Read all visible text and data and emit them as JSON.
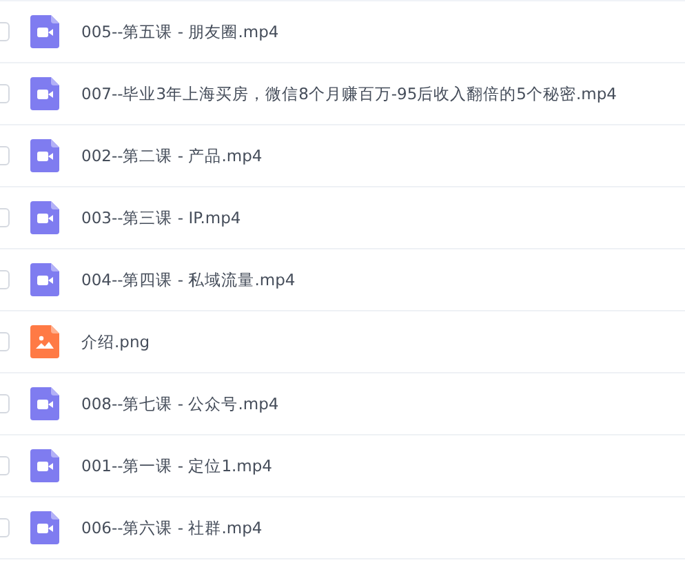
{
  "files": [
    {
      "name": "005--第五课 - 朋友圈.mp4",
      "kind": "video",
      "checked": false
    },
    {
      "name": "007--毕业3年上海买房，微信8个月赚百万-95后收入翻倍的5个秘密.mp4",
      "kind": "video",
      "checked": false
    },
    {
      "name": "002--第二课 - 产品.mp4",
      "kind": "video",
      "checked": false
    },
    {
      "name": "003--第三课 - IP.mp4",
      "kind": "video",
      "checked": false
    },
    {
      "name": "004--第四课 - 私域流量.mp4",
      "kind": "video",
      "checked": false
    },
    {
      "name": "介绍.png",
      "kind": "image",
      "checked": false
    },
    {
      "name": "008--第七课 - 公众号.mp4",
      "kind": "video",
      "checked": false
    },
    {
      "name": "001--第一课 - 定位1.mp4",
      "kind": "video",
      "checked": false
    },
    {
      "name": "006--第六课 - 社群.mp4",
      "kind": "video",
      "checked": false
    }
  ]
}
